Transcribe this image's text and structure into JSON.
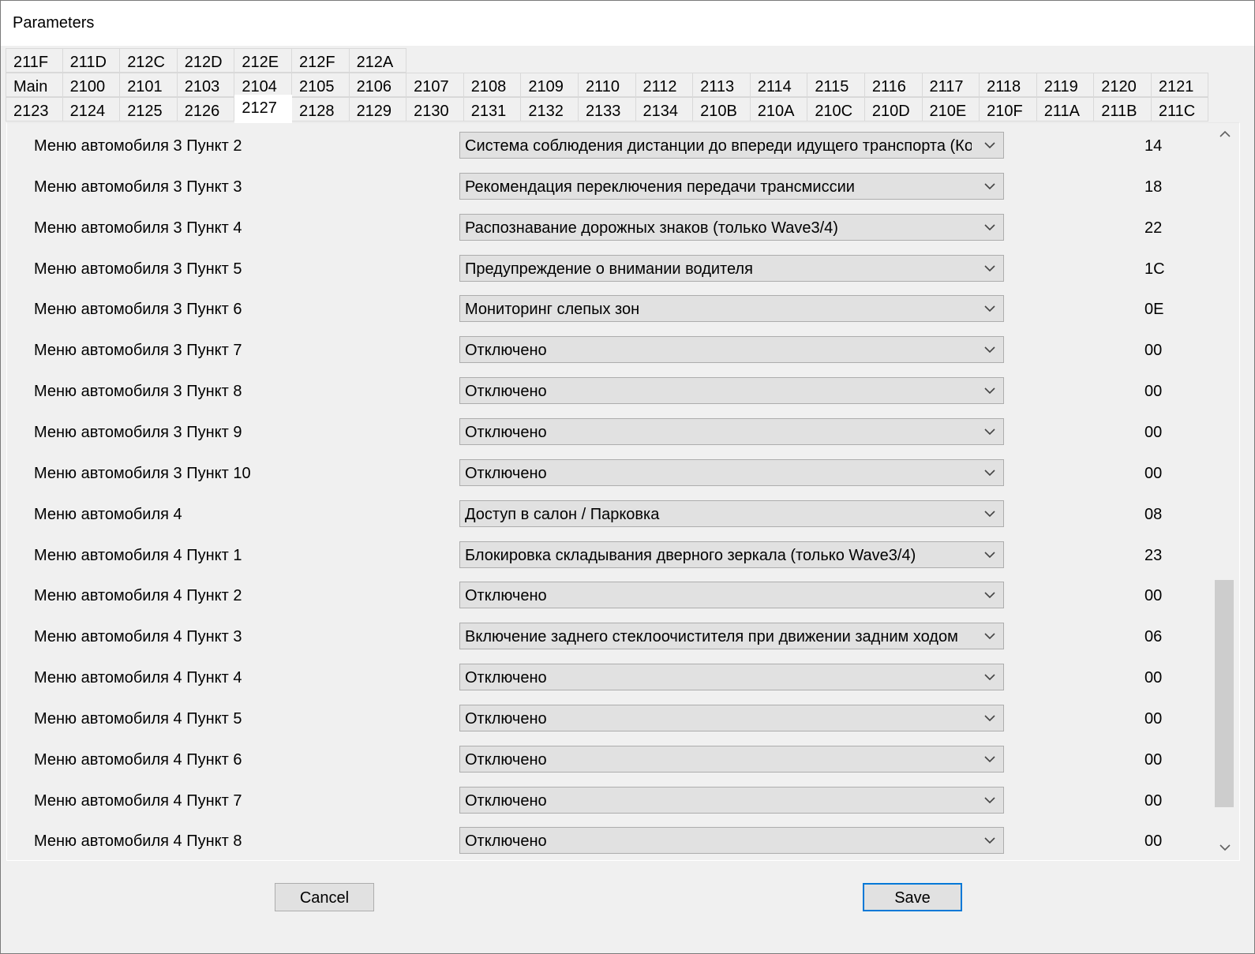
{
  "window": {
    "title": "Parameters"
  },
  "tabs": {
    "row1": [
      "211F",
      "211D",
      "212C",
      "212D",
      "212E",
      "212F",
      "212A"
    ],
    "row2": [
      "Main",
      "2100",
      "2101",
      "2103",
      "2104",
      "2105",
      "2106",
      "2107",
      "2108",
      "2109",
      "2110",
      "2112",
      "2113",
      "2114",
      "2115",
      "2116",
      "2117",
      "2118",
      "2119",
      "2120",
      "2121"
    ],
    "row3": [
      "2123",
      "2124",
      "2125",
      "2126",
      "2127",
      "2128",
      "2129",
      "2130",
      "2131",
      "2132",
      "2133",
      "2134",
      "210B",
      "210A",
      "210C",
      "210D",
      "210E",
      "210F",
      "211A",
      "211B",
      "211C"
    ],
    "active": "2127"
  },
  "rows": [
    {
      "label": "Меню автомобиля 3 Пункт 2",
      "value": "Система соблюдения дистанции до впереди идущего транспорта (Конфиг",
      "code": "14"
    },
    {
      "label": "Меню автомобиля 3 Пункт 3",
      "value": "Рекомендация переключения передачи трансмиссии",
      "code": "18"
    },
    {
      "label": "Меню автомобиля 3 Пункт 4",
      "value": "Распознавание дорожных знаков (только Wave3/4)",
      "code": "22"
    },
    {
      "label": "Меню автомобиля 3 Пункт 5",
      "value": "Предупреждение о внимании водителя",
      "code": "1C"
    },
    {
      "label": "Меню автомобиля 3 Пункт 6",
      "value": "Мониторинг слепых зон",
      "code": "0E"
    },
    {
      "label": "Меню автомобиля 3 Пункт 7",
      "value": "Отключено",
      "code": "00"
    },
    {
      "label": "Меню автомобиля 3 Пункт 8",
      "value": "Отключено",
      "code": "00"
    },
    {
      "label": "Меню автомобиля 3 Пункт 9",
      "value": "Отключено",
      "code": "00"
    },
    {
      "label": "Меню автомобиля 3 Пункт 10",
      "value": "Отключено",
      "code": "00"
    },
    {
      "label": "Меню автомобиля 4",
      "value": "Доступ в салон / Парковка",
      "code": "08"
    },
    {
      "label": "Меню автомобиля 4 Пункт 1",
      "value": "Блокировка складывания дверного зеркала (только Wave3/4)",
      "code": "23"
    },
    {
      "label": "Меню автомобиля 4 Пункт 2",
      "value": "Отключено",
      "code": "00"
    },
    {
      "label": "Меню автомобиля 4 Пункт 3",
      "value": "Включение заднего стеклоочистителя при движении задним ходом",
      "code": "06"
    },
    {
      "label": "Меню автомобиля 4 Пункт 4",
      "value": "Отключено",
      "code": "00"
    },
    {
      "label": "Меню автомобиля 4 Пункт 5",
      "value": "Отключено",
      "code": "00"
    },
    {
      "label": "Меню автомобиля 4 Пункт 6",
      "value": "Отключено",
      "code": "00"
    },
    {
      "label": "Меню автомобиля 4 Пункт 7",
      "value": "Отключено",
      "code": "00"
    },
    {
      "label": "Меню автомобиля 4 Пункт 8",
      "value": "Отключено",
      "code": "00"
    }
  ],
  "buttons": {
    "cancel": "Cancel",
    "save": "Save"
  },
  "icons": {
    "dropdown": "chevron-down-icon",
    "scroll_up": "chevron-up-icon",
    "scroll_down": "chevron-down-icon"
  },
  "colors": {
    "focus_border": "#0078d7"
  }
}
